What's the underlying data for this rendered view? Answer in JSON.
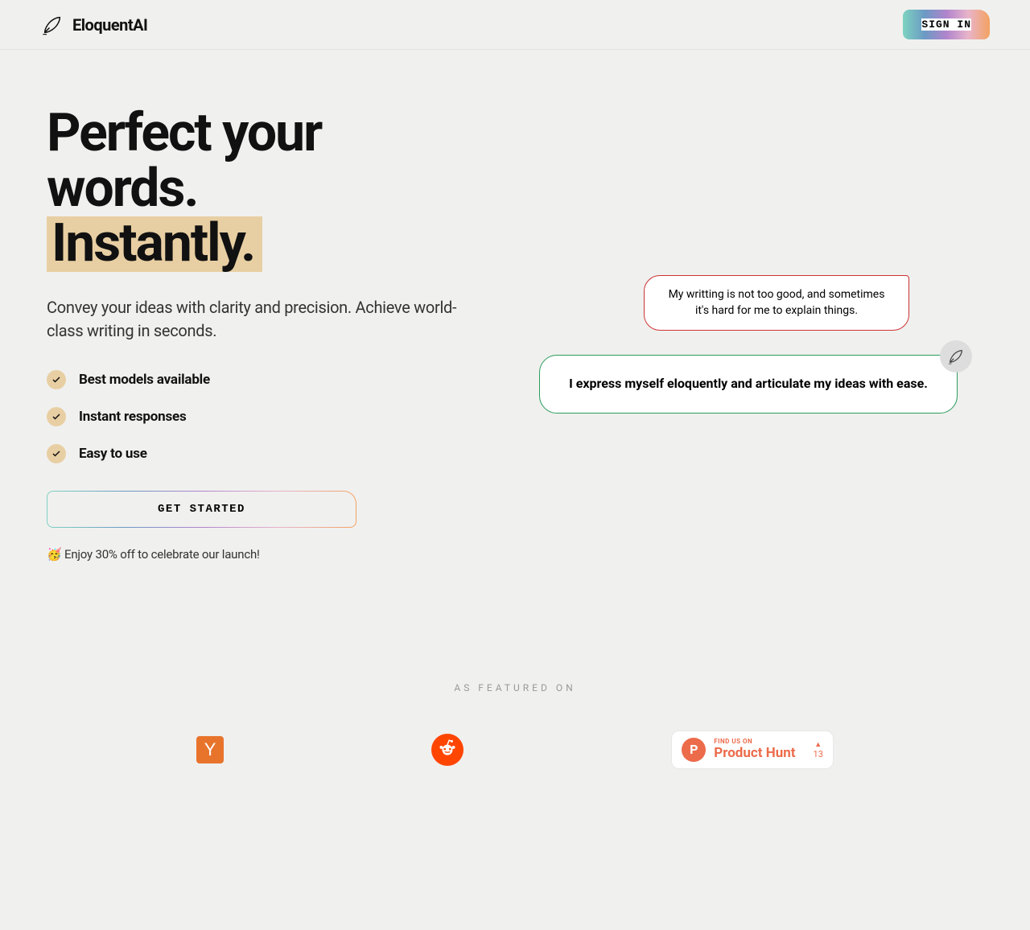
{
  "header": {
    "brand": "EloquentAI",
    "signin": "SIGN IN"
  },
  "hero": {
    "title_line1": "Perfect your words.",
    "title_highlight": "Instantly.",
    "subtitle": "Convey your ideas with clarity and precision. Achieve world-class writing in seconds.",
    "features": [
      "Best models available",
      "Instant responses",
      "Easy to use"
    ],
    "cta": "GET STARTED",
    "promo": "🥳 Enjoy 30% off to celebrate our launch!"
  },
  "demo": {
    "input_bubble": "My writting is not too good, and sometimes it's hard for me to explain things.",
    "output_bubble": "I express myself eloquently and articulate my ideas with ease."
  },
  "featured": {
    "label": "AS FEATURED ON",
    "hn": "Y",
    "ph_find": "FIND US ON",
    "ph_name": "Product Hunt",
    "ph_count": "13",
    "ph_letter": "P"
  }
}
